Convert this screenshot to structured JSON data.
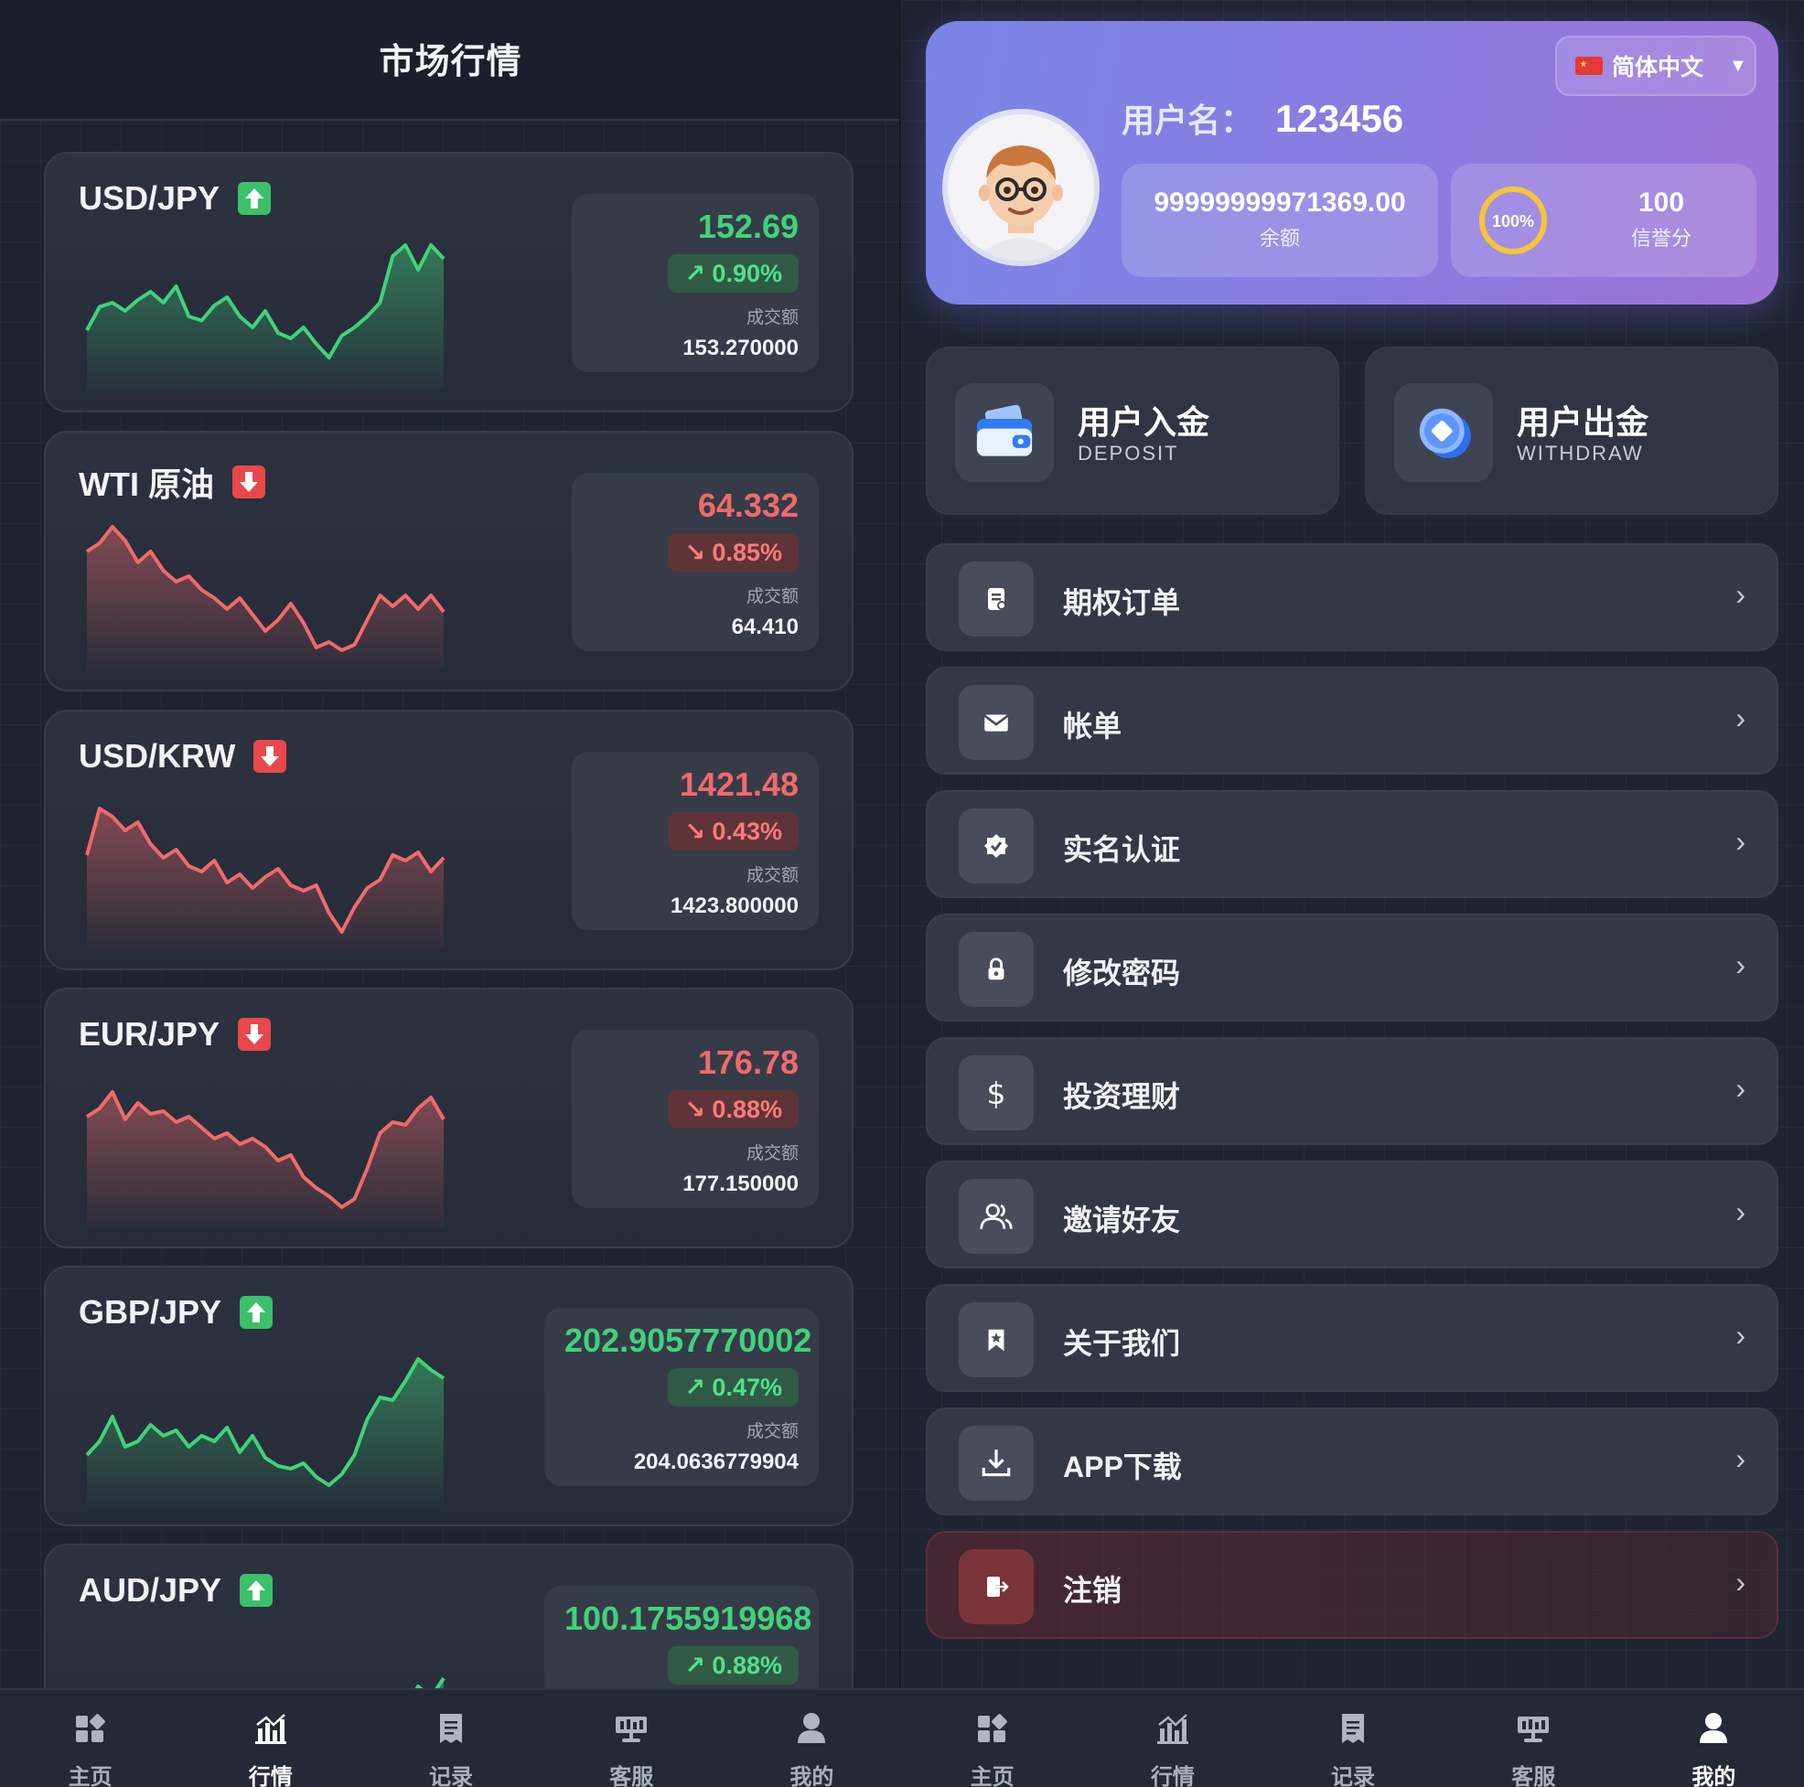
{
  "market": {
    "title": "市场行情",
    "volume_label": "成交额",
    "items": [
      {
        "name": "USD/JPY",
        "trend": "up",
        "price": "152.69",
        "change": "↗ 0.90%",
        "volume": "153.270000",
        "spark": [
          38,
          55,
          58,
          52,
          60,
          66,
          58,
          70,
          48,
          45,
          56,
          62,
          48,
          40,
          52,
          36,
          32,
          40,
          28,
          18,
          34,
          40,
          48,
          58,
          92,
          100,
          82,
          100,
          90
        ]
      },
      {
        "name": "WTI 原油",
        "trend": "down",
        "price": "64.332",
        "change": "↘ 0.85%",
        "volume": "64.410",
        "spark": [
          80,
          86,
          98,
          88,
          72,
          80,
          66,
          58,
          62,
          52,
          46,
          38,
          46,
          34,
          22,
          30,
          42,
          28,
          10,
          14,
          8,
          12,
          30,
          48,
          40,
          48,
          38,
          48,
          36
        ]
      },
      {
        "name": "USD/KRW",
        "trend": "down",
        "price": "1421.48",
        "change": "↘ 0.43%",
        "volume": "1423.800000",
        "spark": [
          62,
          96,
          90,
          80,
          86,
          70,
          60,
          66,
          54,
          50,
          58,
          42,
          48,
          38,
          46,
          52,
          40,
          36,
          40,
          20,
          6,
          24,
          38,
          44,
          62,
          58,
          64,
          50,
          60
        ]
      },
      {
        "name": "EUR/JPY",
        "trend": "down",
        "price": "176.78",
        "change": "↘ 0.88%",
        "volume": "177.150000",
        "spark": [
          74,
          80,
          92,
          72,
          84,
          76,
          78,
          70,
          74,
          66,
          58,
          62,
          54,
          58,
          52,
          42,
          46,
          30,
          22,
          16,
          8,
          14,
          36,
          62,
          70,
          68,
          80,
          88,
          72
        ]
      },
      {
        "name": "GBP/JPY",
        "trend": "up",
        "price": "202.9057770002",
        "change": "↗ 0.47%",
        "volume": "204.0636779904",
        "spark": [
          30,
          40,
          58,
          36,
          40,
          52,
          44,
          48,
          36,
          44,
          40,
          50,
          32,
          44,
          28,
          22,
          20,
          24,
          14,
          8,
          16,
          30,
          56,
          72,
          70,
          84,
          100,
          92,
          86
        ]
      },
      {
        "name": "AUD/JPY",
        "trend": "up",
        "price": "100.1755919968",
        "change": "↗ 0.88%",
        "volume": "",
        "spark": [
          0,
          2,
          0,
          4,
          2,
          0,
          6,
          4,
          2,
          0,
          2,
          4,
          2,
          0,
          2,
          4,
          2,
          0,
          2,
          4,
          6,
          2,
          10,
          30,
          60,
          50,
          64,
          56,
          70
        ]
      }
    ]
  },
  "profile": {
    "language": "简体中文",
    "username_label": "用户名：",
    "username": "123456",
    "balance": "99999999971369.00",
    "balance_label": "余额",
    "credit_percent": "100%",
    "credit_level": 1.0,
    "credit_score": "100",
    "credit_label": "信誉分"
  },
  "actions": {
    "deposit": {
      "title": "用户入金",
      "sub": "DEPOSIT"
    },
    "withdraw": {
      "title": "用户出金",
      "sub": "WITHDRAW"
    }
  },
  "menu": [
    {
      "label": "期权订单",
      "icon": "document-icon"
    },
    {
      "label": "帐单",
      "icon": "mail-icon"
    },
    {
      "label": "实名认证",
      "icon": "verified-badge-icon"
    },
    {
      "label": "修改密码",
      "icon": "lock-icon"
    },
    {
      "label": "投资理财",
      "icon": "dollar-icon"
    },
    {
      "label": "邀请好友",
      "icon": "users-icon"
    },
    {
      "label": "关于我们",
      "icon": "bookmark-star-icon"
    },
    {
      "label": "APP下载",
      "icon": "download-icon"
    },
    {
      "label": "注销",
      "icon": "logout-icon"
    }
  ],
  "nav": {
    "left": [
      {
        "label": "主页",
        "icon": "home-icon"
      },
      {
        "label": "行情",
        "icon": "chart-icon",
        "active": true
      },
      {
        "label": "记录",
        "icon": "records-icon"
      },
      {
        "label": "客服",
        "icon": "support-icon"
      },
      {
        "label": "我的",
        "icon": "user-icon"
      }
    ],
    "right": [
      {
        "label": "主页",
        "icon": "home-icon"
      },
      {
        "label": "行情",
        "icon": "chart-icon"
      },
      {
        "label": "记录",
        "icon": "records-icon"
      },
      {
        "label": "客服",
        "icon": "support-icon"
      },
      {
        "label": "我的",
        "icon": "user-icon",
        "active": true
      }
    ]
  },
  "colors": {
    "up": "#3fd37a",
    "down": "#f06a6a",
    "accent": "#8b7ce0"
  }
}
